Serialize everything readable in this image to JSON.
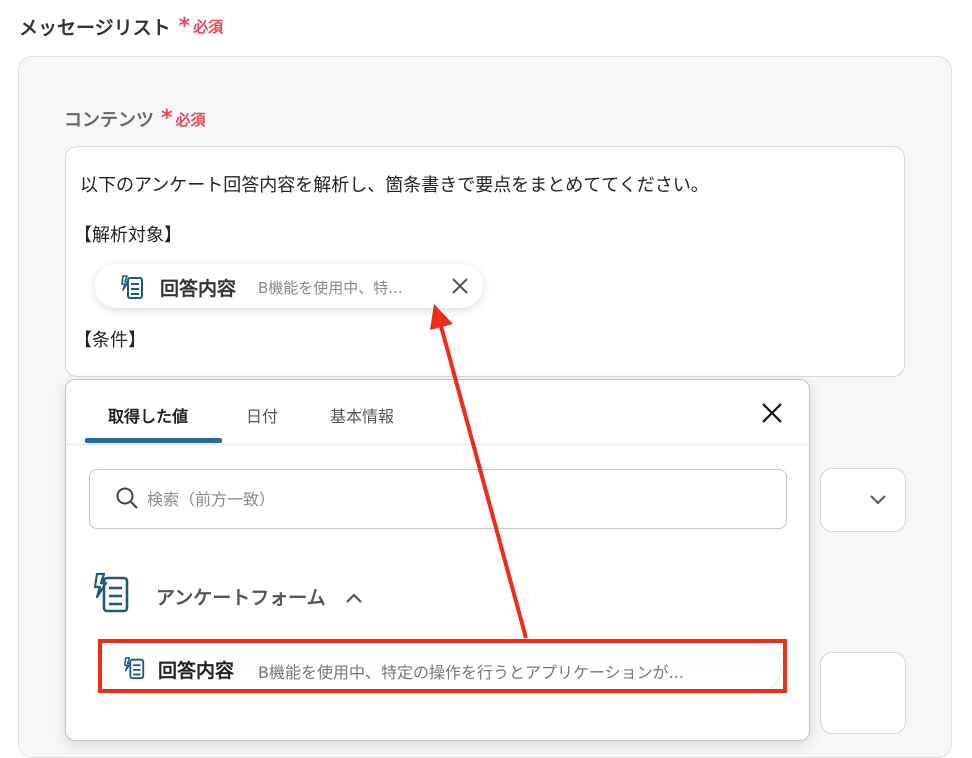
{
  "message_list": {
    "label": "メッセージリスト",
    "required_mark": "*",
    "required_text": "必須"
  },
  "content": {
    "label": "コンテンツ",
    "required_mark": "*",
    "required_text": "必須",
    "line1": "以下のアンケート回答内容を解析し、箇条書きで要点をまとめててください。",
    "line2": "【解析対象】",
    "line3": "【条件】",
    "chip": {
      "icon": "form-icon",
      "title": "回答内容",
      "preview": "B機能を使用中、特...",
      "close_icon": "close-icon"
    }
  },
  "picker": {
    "tabs": [
      {
        "label": "取得した値",
        "active": true
      },
      {
        "label": "日付",
        "active": false
      },
      {
        "label": "基本情報",
        "active": false
      }
    ],
    "close_icon": "close-icon",
    "search": {
      "placeholder": "検索（前方一致）",
      "value": "",
      "icon": "search-icon"
    },
    "group": {
      "icon": "form-icon",
      "title": "アンケートフォーム",
      "toggle_icon": "chevron-up-icon"
    },
    "items": [
      {
        "icon": "form-icon",
        "title": "回答内容",
        "preview": "B機能を使用中、特定の操作を行うとアプリケーションが..."
      }
    ]
  },
  "colors": {
    "required": "#e8475a",
    "tab_accent": "#1f6aa1",
    "annotation": "#ef2c1a",
    "icon": "#1f5a7a"
  }
}
